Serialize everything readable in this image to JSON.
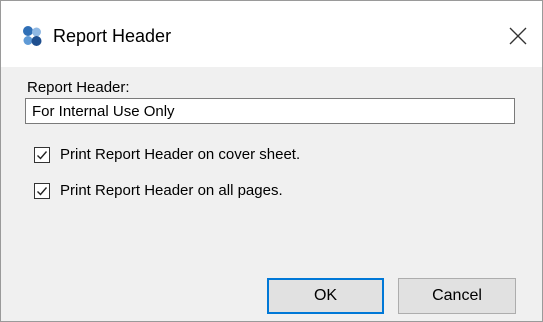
{
  "window": {
    "title": "Report Header",
    "app_icon": "app-logo-icon",
    "close_icon": "close-icon"
  },
  "form": {
    "field_label": "Report Header:",
    "field_value": "For Internal Use Only",
    "checkboxes": [
      {
        "label": "Print Report Header on cover sheet.",
        "checked": true
      },
      {
        "label": "Print Report Header on all pages.",
        "checked": true
      }
    ]
  },
  "buttons": {
    "ok_label": "OK",
    "cancel_label": "Cancel"
  },
  "colors": {
    "accent": "#0078d7",
    "dialog_background": "#f0f0f0",
    "titlebar_background": "#ffffff"
  }
}
